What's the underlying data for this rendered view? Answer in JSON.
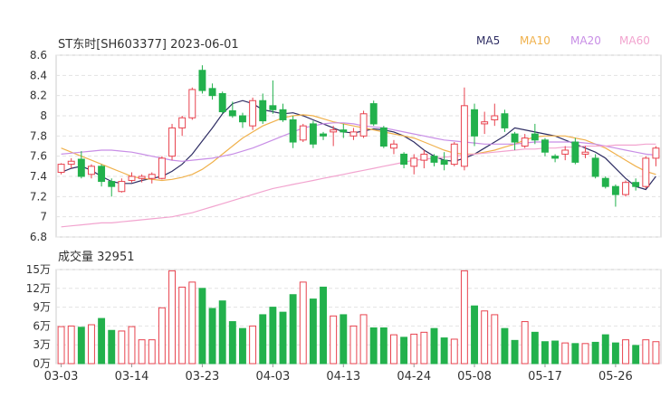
{
  "header": {
    "title": "ST东时[SH603377] 2023-06-01",
    "volume_label": "成交量 32951"
  },
  "legend": [
    {
      "name": "MA5",
      "color": "#2e2d63"
    },
    {
      "name": "MA10",
      "color": "#f0b14c"
    },
    {
      "name": "MA20",
      "color": "#c88ee6"
    },
    {
      "name": "MA60",
      "color": "#f2a4cf"
    }
  ],
  "colors": {
    "up": "#e8434f",
    "down": "#22b14c"
  },
  "chart_data": [
    {
      "type": "candlestick",
      "title": "ST东时[SH603377] 2023-06-01",
      "y_ticks": [
        "8.6",
        "8.4",
        "8.2",
        "8",
        "7.8",
        "7.6",
        "7.4",
        "7.2",
        "7",
        "6.8"
      ],
      "ylim": [
        6.8,
        8.6
      ],
      "x_ticks": [
        {
          "label": "03-03",
          "index": 0
        },
        {
          "label": "03-14",
          "index": 7
        },
        {
          "label": "03-23",
          "index": 14
        },
        {
          "label": "04-03",
          "index": 21
        },
        {
          "label": "04-13",
          "index": 28
        },
        {
          "label": "04-24",
          "index": 35
        },
        {
          "label": "05-08",
          "index": 41
        },
        {
          "label": "05-17",
          "index": 48
        },
        {
          "label": "05-26",
          "index": 55
        }
      ],
      "ohlc": [
        [
          7.44,
          7.53,
          7.42,
          7.52
        ],
        [
          7.52,
          7.58,
          7.48,
          7.55
        ],
        [
          7.57,
          7.65,
          7.38,
          7.4
        ],
        [
          7.42,
          7.52,
          7.38,
          7.5
        ],
        [
          7.5,
          7.52,
          7.3,
          7.35
        ],
        [
          7.35,
          7.38,
          7.2,
          7.3
        ],
        [
          7.25,
          7.38,
          7.24,
          7.35
        ],
        [
          7.36,
          7.44,
          7.34,
          7.4
        ],
        [
          7.38,
          7.42,
          7.34,
          7.4
        ],
        [
          7.38,
          7.44,
          7.33,
          7.42
        ],
        [
          7.38,
          7.6,
          7.37,
          7.58
        ],
        [
          7.6,
          7.92,
          7.56,
          7.88
        ],
        [
          7.88,
          8.0,
          7.8,
          7.98
        ],
        [
          7.98,
          8.28,
          7.96,
          8.26
        ],
        [
          8.45,
          8.5,
          8.22,
          8.25
        ],
        [
          8.27,
          8.32,
          8.16,
          8.2
        ],
        [
          8.22,
          8.24,
          8.02,
          8.04
        ],
        [
          8.05,
          8.14,
          7.98,
          8.0
        ],
        [
          8.0,
          8.03,
          7.88,
          7.94
        ],
        [
          7.9,
          8.18,
          7.86,
          8.15
        ],
        [
          8.15,
          8.22,
          7.92,
          7.95
        ],
        [
          8.1,
          8.35,
          8.02,
          8.06
        ],
        [
          8.06,
          8.12,
          7.94,
          7.96
        ],
        [
          7.96,
          8.0,
          7.68,
          7.74
        ],
        [
          7.76,
          7.92,
          7.74,
          7.9
        ],
        [
          7.92,
          7.95,
          7.68,
          7.72
        ],
        [
          7.82,
          7.84,
          7.76,
          7.8
        ],
        [
          7.84,
          7.9,
          7.7,
          7.86
        ],
        [
          7.86,
          7.92,
          7.78,
          7.84
        ],
        [
          7.8,
          7.88,
          7.76,
          7.84
        ],
        [
          7.8,
          8.05,
          7.78,
          8.02
        ],
        [
          8.12,
          8.15,
          7.9,
          7.92
        ],
        [
          7.88,
          7.9,
          7.68,
          7.7
        ],
        [
          7.68,
          7.76,
          7.62,
          7.72
        ],
        [
          7.62,
          7.64,
          7.48,
          7.52
        ],
        [
          7.5,
          7.62,
          7.42,
          7.58
        ],
        [
          7.56,
          7.66,
          7.48,
          7.62
        ],
        [
          7.6,
          7.62,
          7.5,
          7.54
        ],
        [
          7.56,
          7.64,
          7.46,
          7.52
        ],
        [
          7.52,
          7.74,
          7.5,
          7.72
        ],
        [
          7.5,
          8.28,
          7.46,
          8.1
        ],
        [
          8.06,
          8.12,
          7.7,
          7.8
        ],
        [
          7.92,
          8.04,
          7.82,
          7.94
        ],
        [
          7.96,
          8.12,
          7.9,
          8.0
        ],
        [
          8.02,
          8.06,
          7.84,
          7.88
        ],
        [
          7.82,
          7.84,
          7.66,
          7.74
        ],
        [
          7.7,
          7.82,
          7.68,
          7.78
        ],
        [
          7.82,
          7.92,
          7.72,
          7.76
        ],
        [
          7.76,
          7.78,
          7.6,
          7.64
        ],
        [
          7.6,
          7.62,
          7.54,
          7.58
        ],
        [
          7.62,
          7.7,
          7.56,
          7.66
        ],
        [
          7.74,
          7.78,
          7.52,
          7.54
        ],
        [
          7.62,
          7.7,
          7.58,
          7.64
        ],
        [
          7.58,
          7.62,
          7.38,
          7.4
        ],
        [
          7.38,
          7.4,
          7.28,
          7.3
        ],
        [
          7.3,
          7.32,
          7.1,
          7.22
        ],
        [
          7.22,
          7.36,
          7.2,
          7.34
        ],
        [
          7.34,
          7.38,
          7.26,
          7.3
        ],
        [
          7.3,
          7.6,
          7.28,
          7.58
        ],
        [
          7.58,
          7.7,
          7.5,
          7.68
        ]
      ],
      "ma5": [
        7.44,
        7.48,
        7.5,
        7.46,
        7.4,
        7.35,
        7.33,
        7.33,
        7.36,
        7.38,
        7.4,
        7.45,
        7.52,
        7.62,
        7.75,
        7.88,
        8.02,
        8.12,
        8.15,
        8.12,
        8.06,
        8.04,
        8.02,
        8.03,
        8.0,
        7.96,
        7.92,
        7.88,
        7.84,
        7.83,
        7.85,
        7.87,
        7.86,
        7.84,
        7.8,
        7.74,
        7.66,
        7.6,
        7.56,
        7.55,
        7.58,
        7.62,
        7.68,
        7.74,
        7.8,
        7.88,
        7.86,
        7.84,
        7.82,
        7.8,
        7.76,
        7.72,
        7.68,
        7.64,
        7.58,
        7.48,
        7.38,
        7.3,
        7.27,
        7.4
      ],
      "ma10": [
        7.68,
        7.64,
        7.6,
        7.56,
        7.52,
        7.48,
        7.44,
        7.4,
        7.38,
        7.37,
        7.36,
        7.37,
        7.39,
        7.42,
        7.47,
        7.54,
        7.62,
        7.7,
        7.78,
        7.84,
        7.9,
        7.94,
        7.98,
        8.0,
        8.01,
        8.0,
        7.97,
        7.94,
        7.92,
        7.9,
        7.88,
        7.86,
        7.84,
        7.82,
        7.8,
        7.78,
        7.74,
        7.7,
        7.66,
        7.63,
        7.62,
        7.62,
        7.64,
        7.66,
        7.69,
        7.72,
        7.76,
        7.79,
        7.8,
        7.8,
        7.8,
        7.78,
        7.76,
        7.72,
        7.68,
        7.62,
        7.56,
        7.5,
        7.45,
        7.42
      ],
      "ma20": [
        7.62,
        7.63,
        7.64,
        7.65,
        7.66,
        7.66,
        7.65,
        7.64,
        7.62,
        7.6,
        7.58,
        7.56,
        7.55,
        7.56,
        7.57,
        7.58,
        7.6,
        7.62,
        7.65,
        7.68,
        7.72,
        7.76,
        7.8,
        7.84,
        7.88,
        7.9,
        7.92,
        7.93,
        7.93,
        7.92,
        7.9,
        7.89,
        7.88,
        7.86,
        7.84,
        7.82,
        7.8,
        7.78,
        7.76,
        7.75,
        7.74,
        7.73,
        7.72,
        7.72,
        7.72,
        7.72,
        7.73,
        7.74,
        7.74,
        7.74,
        7.74,
        7.74,
        7.73,
        7.72,
        7.7,
        7.68,
        7.66,
        7.64,
        7.62,
        7.61
      ],
      "ma60": [
        6.9,
        6.91,
        6.92,
        6.93,
        6.94,
        6.94,
        6.95,
        6.96,
        6.97,
        6.98,
        6.99,
        7.0,
        7.02,
        7.04,
        7.07,
        7.1,
        7.13,
        7.16,
        7.19,
        7.22,
        7.25,
        7.28,
        7.3,
        7.32,
        7.34,
        7.36,
        7.38,
        7.4,
        7.42,
        7.44,
        7.46,
        7.48,
        7.5,
        7.52,
        7.54,
        7.56,
        7.57,
        7.58,
        7.59,
        7.6,
        7.61,
        7.62,
        7.63,
        7.64,
        7.65,
        7.66,
        7.67,
        7.67,
        7.68,
        7.68,
        7.69,
        7.69,
        7.7,
        7.7,
        7.7,
        7.71,
        7.71,
        7.71,
        7.72,
        7.72
      ]
    },
    {
      "type": "bar",
      "title": "成交量 32951",
      "y_ticks": [
        "15万",
        "12万",
        "9万",
        "6万",
        "3万",
        "0万"
      ],
      "ylim": [
        0,
        15
      ],
      "unit": "万",
      "values": [
        5.9,
        6.0,
        5.8,
        6.2,
        7.2,
        5.3,
        5.2,
        5.9,
        3.8,
        3.8,
        8.9,
        14.8,
        12.2,
        13.0,
        12.0,
        8.8,
        10.0,
        6.7,
        5.6,
        6.0,
        7.8,
        9.0,
        8.2,
        11.0,
        13.0,
        10.3,
        12.2,
        7.6,
        7.8,
        6.0,
        7.8,
        5.7,
        5.7,
        4.6,
        4.2,
        4.7,
        5.0,
        5.6,
        4.1,
        3.9,
        14.8,
        9.2,
        8.4,
        7.8,
        5.6,
        3.7,
        6.7,
        5.0,
        3.5,
        3.6,
        3.3,
        3.2,
        3.2,
        3.4,
        4.6,
        3.3,
        3.8,
        2.9,
        3.8,
        3.5
      ]
    }
  ]
}
